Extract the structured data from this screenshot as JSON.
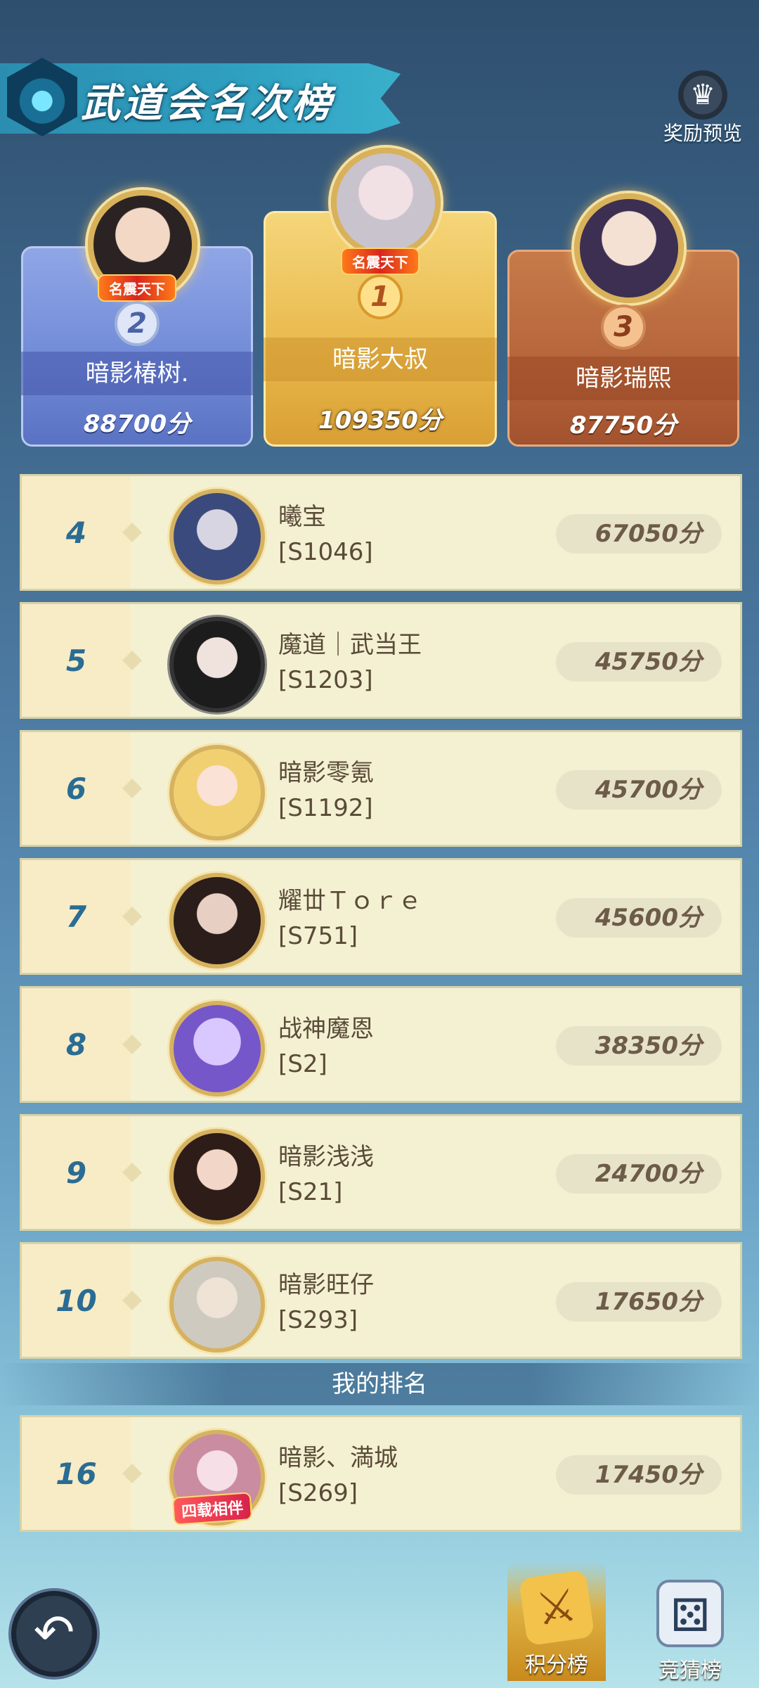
{
  "header": {
    "title": "武道会名次榜",
    "reward_label": "奖励预览"
  },
  "podium": [
    {
      "place": "2",
      "name": "暗影椿树.",
      "score": "88700分",
      "title_badge": "名震天下"
    },
    {
      "place": "1",
      "name": "暗影大叔",
      "score": "109350分",
      "title_badge": "名震天下"
    },
    {
      "place": "3",
      "name": "暗影瑞熙",
      "score": "87750分",
      "title_badge": ""
    }
  ],
  "rows": [
    {
      "rank": "4",
      "name": "曦宝",
      "server": "[S1046]",
      "score": "67050分"
    },
    {
      "rank": "5",
      "name": "魔道｜武当王",
      "server": "[S1203]",
      "score": "45750分"
    },
    {
      "rank": "6",
      "name": "暗影零氪",
      "server": "[S1192]",
      "score": "45700分"
    },
    {
      "rank": "7",
      "name": "耀丗Ｔｏｒｅ",
      "server": "[S751]",
      "score": "45600分"
    },
    {
      "rank": "8",
      "name": "战神魔恩",
      "server": "[S2]",
      "score": "38350分"
    },
    {
      "rank": "9",
      "name": "暗影浅浅",
      "server": "[S21]",
      "score": "24700分"
    },
    {
      "rank": "10",
      "name": "暗影旺仔",
      "server": "[S293]",
      "score": "17650分"
    }
  ],
  "my_rank": {
    "label": "我的排名",
    "rank": "16",
    "name": "暗影、満城",
    "server": "[S269]",
    "score": "17450分",
    "badge": "四载相伴"
  },
  "bottom_tabs": {
    "score_board": "积分榜",
    "guess_board": "竞猜榜"
  },
  "icons": {
    "back": "back-arrow-icon",
    "reward": "crown-icon",
    "score_tab": "crossed-swords-icon",
    "guess_tab": "dice-icon"
  }
}
